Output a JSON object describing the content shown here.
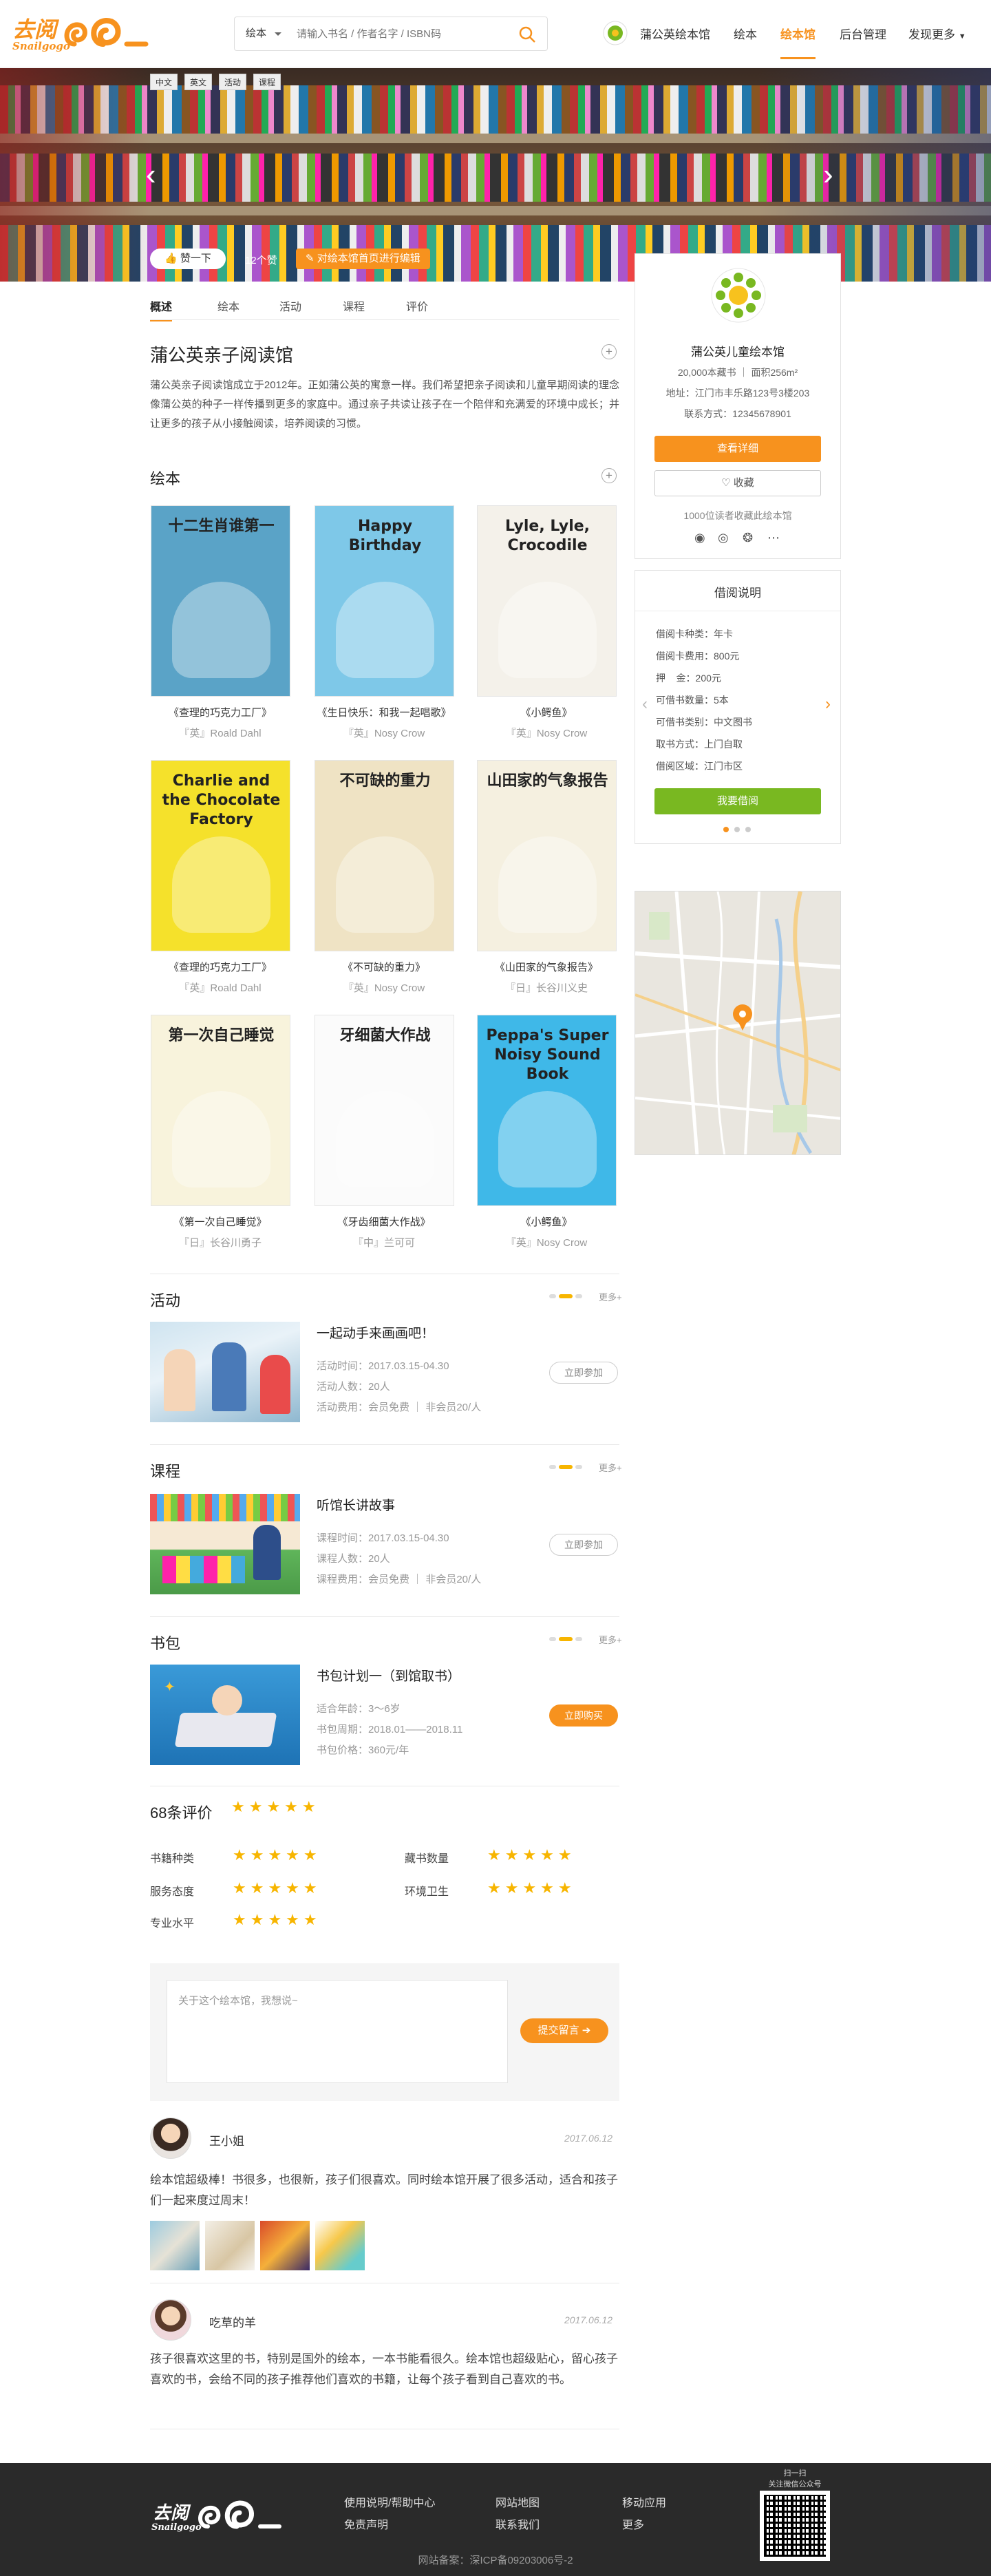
{
  "header": {
    "logo_cn": "去阅",
    "logo_en": "Snailgogo",
    "search_category": "绘本",
    "search_placeholder": "请输入书名 / 作者名字 / ISBN码",
    "library_name": "蒲公英绘本馆",
    "nav": [
      "绘本",
      "绘本馆",
      "后台管理",
      "发现更多"
    ],
    "nav_active": "绘本馆"
  },
  "hero": {
    "tags": [
      "中文",
      "英文",
      "活动",
      "课程"
    ],
    "like_label": "赞一下",
    "like_count": "12个赞",
    "edit_label": "对绘本馆首页进行编辑"
  },
  "tabs": [
    "概述",
    "绘本",
    "活动",
    "课程",
    "评价"
  ],
  "overview": {
    "title": "蒲公英亲子阅读馆",
    "desc": "蒲公英亲子阅读馆成立于2012年。正如蒲公英的寓意一样。我们希望把亲子阅读和儿童早期阅读的理念像蒲公英的种子一样传播到更多的家庭中。通过亲子共读让孩子在一个陪伴和充满爱的环境中成长；并让更多的孩子从小接触阅读，培养阅读的习惯。"
  },
  "books_section": {
    "title": "绘本"
  },
  "books": [
    {
      "title": "《查理的巧克力工厂》",
      "author": "『英』Roald Dahl",
      "cover_text": "十二生肖谁第一",
      "bg": "#5aa3c7"
    },
    {
      "title": "《生日快乐：和我一起唱歌》",
      "author": "『英』Nosy Crow",
      "cover_text": "Happy Birthday",
      "bg": "#7ec8e8"
    },
    {
      "title": "《小鳄鱼》",
      "author": "『英』Nosy Crow",
      "cover_text": "Lyle, Lyle, Crocodile",
      "bg": "#f4f1ea"
    },
    {
      "title": "《查理的巧克力工厂》",
      "author": "『英』Roald Dahl",
      "cover_text": "Charlie and the Chocolate Factory",
      "bg": "#f5e12b"
    },
    {
      "title": "《不可缺的重力》",
      "author": "『英』Nosy Crow",
      "cover_text": "不可缺的重力",
      "bg": "#efe3c4"
    },
    {
      "title": "《山田家的气象报告》",
      "author": "『日』长谷川义史",
      "cover_text": "山田家的气象报告",
      "bg": "#f5f0e0"
    },
    {
      "title": "《第一次自己睡觉》",
      "author": "『日』长谷川勇子",
      "cover_text": "第一次自己睡觉",
      "bg": "#f8f3dc"
    },
    {
      "title": "《牙齿细菌大作战》",
      "author": "『中』兰可可",
      "cover_text": "牙细菌大作战",
      "bg": "#fbfbfb"
    },
    {
      "title": "《小鳄鱼》",
      "author": "『英』Nosy Crow",
      "cover_text": "Peppa's Super Noisy Sound Book",
      "bg": "#3fb8e8"
    }
  ],
  "activity": {
    "title": "活动",
    "more": "更多+",
    "item_title": "一起动手来画画吧！",
    "time": "活动时间：2017.03.15-04.30",
    "people": "活动人数：20人",
    "fee": "活动费用：会员免费 ｜ 非会员20/人",
    "button": "立即参加"
  },
  "course": {
    "title": "课程",
    "more": "更多+",
    "item_title": "听馆长讲故事",
    "time": "课程时间：2017.03.15-04.30",
    "people": "课程人数：20人",
    "fee": "课程费用：会员免费 ｜ 非会员20/人",
    "button": "立即参加"
  },
  "bookbag": {
    "title": "书包",
    "more": "更多+",
    "item_title": "书包计划一（到馆取书）",
    "age": "适合年龄：3～6岁",
    "period": "书包周期：2018.01——2018.11",
    "price": "书包价格：360元/年",
    "button": "立即购买"
  },
  "reviews": {
    "count_title": "68条评价",
    "overall_stars": 5,
    "ratings": [
      {
        "label": "书籍种类",
        "stars": 5
      },
      {
        "label": "藏书数量",
        "stars": 5
      },
      {
        "label": "服务态度",
        "stars": 5
      },
      {
        "label": "环境卫生",
        "stars": 5
      },
      {
        "label": "专业水平",
        "stars": 5
      }
    ],
    "input_placeholder": "关于这个绘本馆，我想说~",
    "submit": "提交留言",
    "comments": [
      {
        "name": "王小姐",
        "date": "2017.06.12",
        "text": "绘本馆超级棒！书很多，也很新，孩子们很喜欢。同时绘本馆开展了很多活动，适合和孩子们一起来度过周末！"
      },
      {
        "name": "吃草的羊",
        "date": "2017.06.12",
        "text": "孩子很喜欢这里的书，特别是国外的绘本，一本书能看很久。绘本馆也超级贴心，留心孩子喜欢的书，会给不同的孩子推荐他们喜欢的书籍，让每个孩子看到自己喜欢的书。"
      }
    ]
  },
  "sidebar": {
    "name": "蒲公英儿童绘本馆",
    "stats": "20,000本藏书 ｜ 面积256m²",
    "address": "地址：江门市丰乐路123号3楼203",
    "phone": "联系方式：12345678901",
    "detail_btn": "查看详细",
    "fav_btn": "收藏",
    "fav_count": "1000位读者收藏此绘本馆",
    "borrow_title": "借阅说明",
    "borrow_lines": [
      "借阅卡种类：年卡",
      "借阅卡费用：800元",
      "押    金：200元",
      "可借书数量：5本",
      "可借书类别：中文图书",
      "取书方式：上门自取",
      "借阅区域：江门市区"
    ],
    "borrow_btn": "我要借阅"
  },
  "footer": {
    "logo_cn": "去阅",
    "logo_en": "Snailgogo",
    "links": [
      "使用说明/帮助中心",
      "免责声明",
      "网站地图",
      "联系我们",
      "移动应用",
      "更多"
    ],
    "qr_title": "扫一扫",
    "qr_sub": "关注微信公众号",
    "icp": "网站备案：深ICP备09203006号-2"
  }
}
